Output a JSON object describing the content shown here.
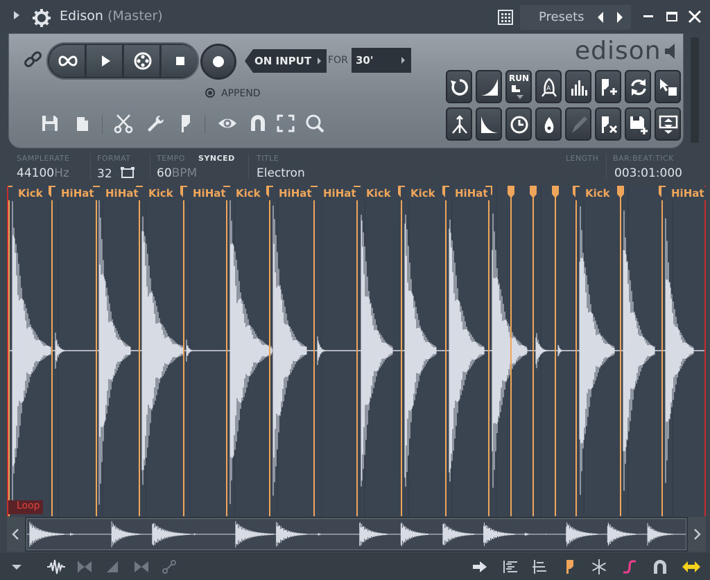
{
  "window": {
    "title": "Edison",
    "subtitle": "(Master)",
    "presets_label": "Presets"
  },
  "transport": {
    "on_input_label": "ON INPUT",
    "for_label": "FOR",
    "duration_value": "30'",
    "append_label": "APPEND"
  },
  "logo_text": "edison",
  "grid_buttons": {
    "run_label": "RUN"
  },
  "info": {
    "samplerate_label": "SAMPLERATE",
    "samplerate_value": "44100",
    "samplerate_unit": "Hz",
    "format_label": "FORMAT",
    "format_value": "32",
    "tempo_label": "TEMPO",
    "tempo_value": "60",
    "tempo_unit": "BPM",
    "synced_label": "SYNCED",
    "title_label": "TITLE",
    "title_value": "Electron",
    "length_label": "LENGTH",
    "position_label": "BAR:BEAT:TICK",
    "position_value": "003:01:000"
  },
  "markers": [
    "Kick",
    "HiHat",
    "HiHat",
    "Kick",
    "HiHat",
    "Kick",
    "HiHat",
    "HiHat",
    "Kick",
    "Kick",
    "HiHat",
    "Kick",
    "HiHat"
  ],
  "loop_label": "Loop",
  "colors": {
    "marker": "#f0a65a",
    "waveform": "#d7dbe3",
    "loop": "#e0443a",
    "background": "#3a4350",
    "bottom_highlight": "#f5d31c"
  },
  "icons": {
    "titlebar": [
      "menu-arrow-icon",
      "gear-icon",
      "browser-grid-icon",
      "preset-prev-icon",
      "preset-next-icon",
      "minimize-icon",
      "maximize-icon",
      "close-icon"
    ],
    "tools": [
      "save-icon",
      "copy-icon",
      "scissors-icon",
      "wrench-icon",
      "flag-icon",
      "eye-icon",
      "magnet-icon",
      "select-all-icon",
      "zoom-icon"
    ],
    "bottom": [
      "dropdown-icon",
      "waveform-icon",
      "bowtie-icon",
      "ramp-icon",
      "normalize-icon",
      "link-icon",
      "arrow-right-icon",
      "align-left-icon",
      "align-bar-icon",
      "marker-flag-icon",
      "freeze-icon",
      "curve-icon",
      "snap-magnet-icon",
      "scroll-arrows-icon"
    ]
  }
}
